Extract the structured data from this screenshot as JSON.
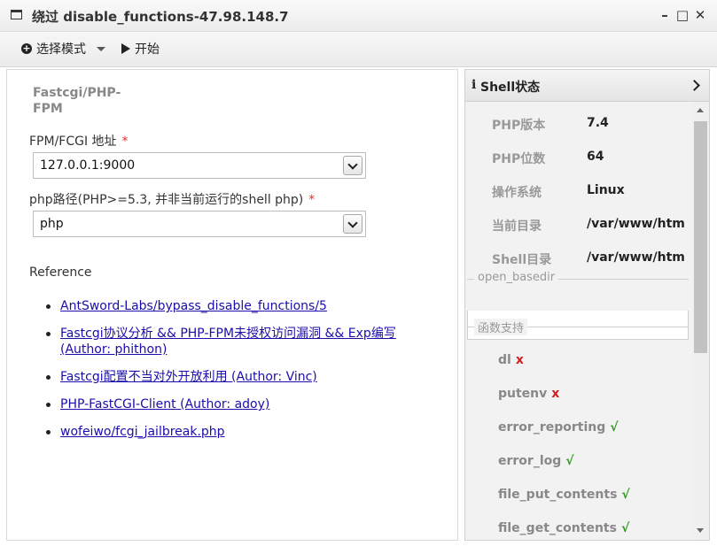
{
  "window": {
    "title": "绕过 disable_functions-47.98.148.7",
    "controls": {
      "minimize": "–",
      "maximize": "□",
      "close": "✕"
    }
  },
  "toolbar": {
    "mode_label": "选择模式",
    "start_label": "开始"
  },
  "form": {
    "section_title": "Fastcgi/PHP-FPM",
    "fpm_label": "FPM/FCGI 地址",
    "fpm_value": "127.0.0.1:9000",
    "php_label": "php路径(PHP>=5.3, 并非当前运行的shell php)",
    "php_value": "php",
    "required_mark": "*"
  },
  "reference": {
    "title": "Reference",
    "links": [
      "AntSword-Labs/bypass_disable_functions/5",
      "Fastcgi协议分析 && PHP-FPM未授权访问漏洞 && Exp编写(Author: phithon)",
      "Fastcgi配置不当对外开放利用 (Author: Vinc)",
      "PHP-FastCGI-Client (Author: adoy)",
      "wofeiwo/fcgi_jailbreak.php"
    ]
  },
  "shell_status": {
    "header": "Shell状态",
    "info_icon": "i",
    "stats": [
      {
        "key": "PHP版本",
        "value": "7.4"
      },
      {
        "key": "PHP位数",
        "value": "64"
      },
      {
        "key": "操作系统",
        "value": "Linux"
      },
      {
        "key": "当前目录",
        "value": "/var/www/htm"
      },
      {
        "key": "Shell目录",
        "value": "/var/www/htm"
      }
    ],
    "basedir_legend": "open_basedir",
    "func_legend": "函数支持",
    "functions": [
      {
        "name": "dl",
        "mark": "x"
      },
      {
        "name": "putenv",
        "mark": "x"
      },
      {
        "name": "error_reporting",
        "mark": "√"
      },
      {
        "name": "error_log",
        "mark": "√"
      },
      {
        "name": "file_put_contents",
        "mark": "√"
      },
      {
        "name": "file_get_contents",
        "mark": "√"
      }
    ]
  },
  "colors": {
    "required": "#e03131",
    "link": "#1a0dab",
    "fail": "#d81e1e",
    "ok": "#2e9a1c"
  }
}
